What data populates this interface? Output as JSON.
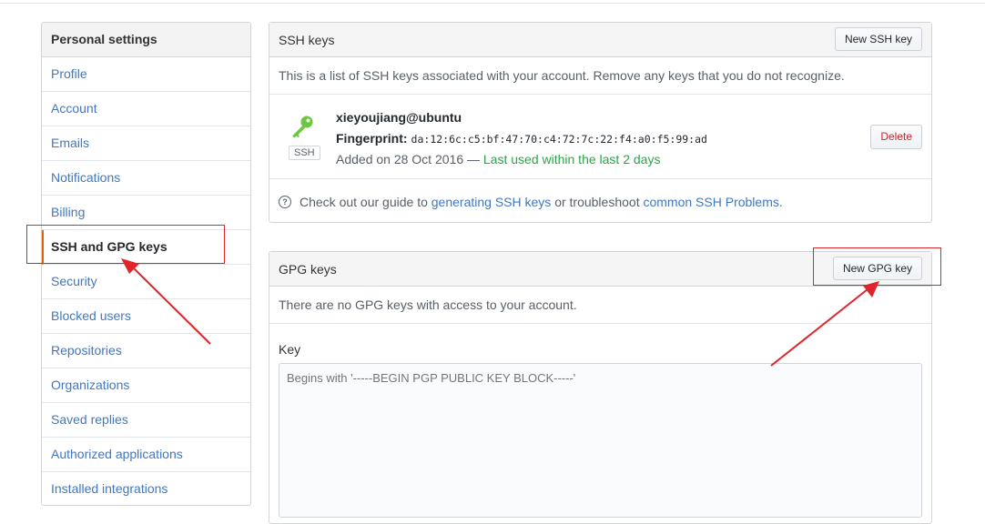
{
  "sidebar": {
    "header": "Personal settings",
    "items": [
      {
        "label": "Profile"
      },
      {
        "label": "Account"
      },
      {
        "label": "Emails"
      },
      {
        "label": "Notifications"
      },
      {
        "label": "Billing"
      },
      {
        "label": "SSH and GPG keys",
        "selected": true
      },
      {
        "label": "Security"
      },
      {
        "label": "Blocked users"
      },
      {
        "label": "Repositories"
      },
      {
        "label": "Organizations"
      },
      {
        "label": "Saved replies"
      },
      {
        "label": "Authorized applications"
      },
      {
        "label": "Installed integrations"
      }
    ]
  },
  "ssh": {
    "title": "SSH keys",
    "new_button": "New SSH key",
    "description": "This is a list of SSH keys associated with your account. Remove any keys that you do not recognize.",
    "key": {
      "icon": "key-icon",
      "badge": "SSH",
      "name": "xieyoujiang@ubuntu",
      "fingerprint_label": "Fingerprint:",
      "fingerprint": "da:12:6c:c5:bf:47:70:c4:72:7c:22:f4:a0:f5:99:ad",
      "added": "Added on 28 Oct 2016 —",
      "last_used": "Last used within the last 2 days",
      "delete_button": "Delete"
    },
    "guide": {
      "prefix": "Check out our guide to",
      "link1": "generating SSH keys",
      "middle": "or troubleshoot",
      "link2": "common SSH Problems",
      "suffix": "."
    }
  },
  "gpg": {
    "title": "GPG keys",
    "new_button": "New GPG key",
    "description": "There are no GPG keys with access to your account.",
    "key_label": "Key",
    "key_placeholder": "Begins with '-----BEGIN PGP PUBLIC KEY BLOCK-----'"
  },
  "colors": {
    "link": "#4078c0",
    "annotation": "#e0242a",
    "selected_border": "#e36209",
    "last_used": "#28a745",
    "delete": "#cb2431"
  }
}
